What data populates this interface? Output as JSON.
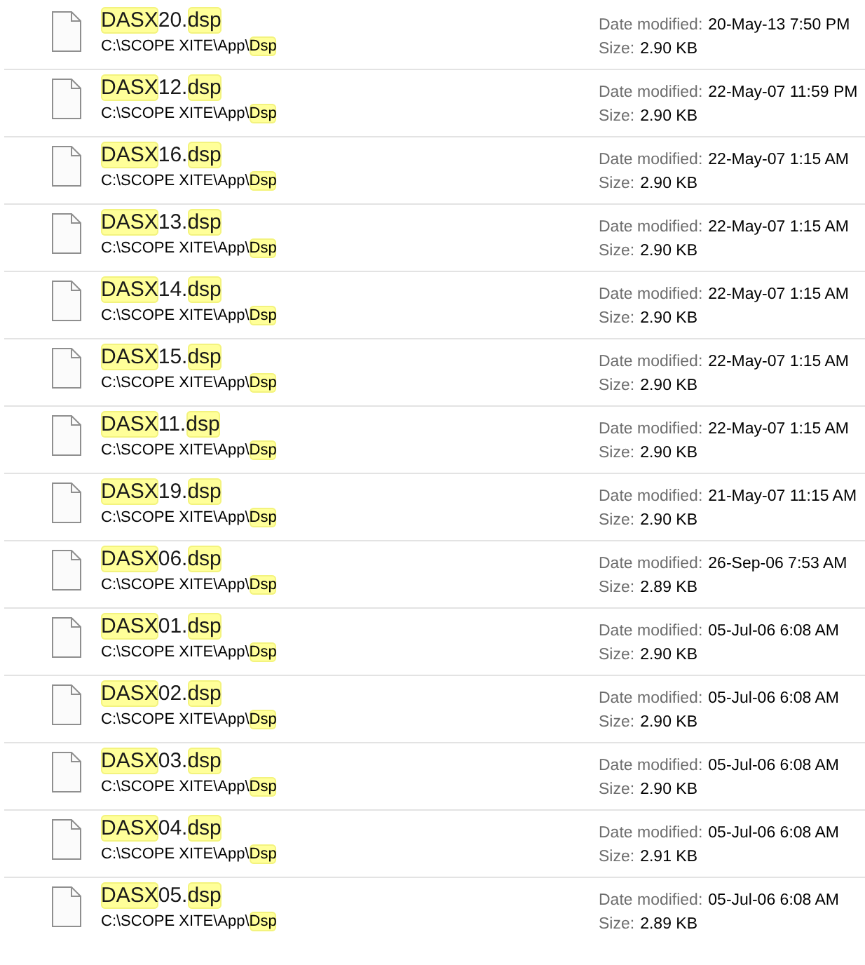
{
  "results": [
    {
      "name_parts": [
        {
          "text": "DASX",
          "highlighted": true
        },
        {
          "text": "20.",
          "highlighted": false
        },
        {
          "text": "dsp",
          "highlighted": true
        }
      ],
      "path_parts": [
        {
          "text": "C:\\SCOPE XITE\\App\\",
          "highlighted": false
        },
        {
          "text": "Dsp",
          "highlighted": true
        }
      ],
      "date_label": "Date modified:",
      "date": "20-May-13 7:50 PM",
      "size_label": "Size:",
      "size": "2.90 KB"
    },
    {
      "name_parts": [
        {
          "text": "DASX",
          "highlighted": true
        },
        {
          "text": "12.",
          "highlighted": false
        },
        {
          "text": "dsp",
          "highlighted": true
        }
      ],
      "path_parts": [
        {
          "text": "C:\\SCOPE XITE\\App\\",
          "highlighted": false
        },
        {
          "text": "Dsp",
          "highlighted": true
        }
      ],
      "date_label": "Date modified:",
      "date": "22-May-07 11:59 PM",
      "size_label": "Size:",
      "size": "2.90 KB"
    },
    {
      "name_parts": [
        {
          "text": "DASX",
          "highlighted": true
        },
        {
          "text": "16.",
          "highlighted": false
        },
        {
          "text": "dsp",
          "highlighted": true
        }
      ],
      "path_parts": [
        {
          "text": "C:\\SCOPE XITE\\App\\",
          "highlighted": false
        },
        {
          "text": "Dsp",
          "highlighted": true
        }
      ],
      "date_label": "Date modified:",
      "date": "22-May-07 1:15 AM",
      "size_label": "Size:",
      "size": "2.90 KB"
    },
    {
      "name_parts": [
        {
          "text": "DASX",
          "highlighted": true
        },
        {
          "text": "13.",
          "highlighted": false
        },
        {
          "text": "dsp",
          "highlighted": true
        }
      ],
      "path_parts": [
        {
          "text": "C:\\SCOPE XITE\\App\\",
          "highlighted": false
        },
        {
          "text": "Dsp",
          "highlighted": true
        }
      ],
      "date_label": "Date modified:",
      "date": "22-May-07 1:15 AM",
      "size_label": "Size:",
      "size": "2.90 KB"
    },
    {
      "name_parts": [
        {
          "text": "DASX",
          "highlighted": true
        },
        {
          "text": "14.",
          "highlighted": false
        },
        {
          "text": "dsp",
          "highlighted": true
        }
      ],
      "path_parts": [
        {
          "text": "C:\\SCOPE XITE\\App\\",
          "highlighted": false
        },
        {
          "text": "Dsp",
          "highlighted": true
        }
      ],
      "date_label": "Date modified:",
      "date": "22-May-07 1:15 AM",
      "size_label": "Size:",
      "size": "2.90 KB"
    },
    {
      "name_parts": [
        {
          "text": "DASX",
          "highlighted": true
        },
        {
          "text": "15.",
          "highlighted": false
        },
        {
          "text": "dsp",
          "highlighted": true
        }
      ],
      "path_parts": [
        {
          "text": "C:\\SCOPE XITE\\App\\",
          "highlighted": false
        },
        {
          "text": "Dsp",
          "highlighted": true
        }
      ],
      "date_label": "Date modified:",
      "date": "22-May-07 1:15 AM",
      "size_label": "Size:",
      "size": "2.90 KB"
    },
    {
      "name_parts": [
        {
          "text": "DASX",
          "highlighted": true
        },
        {
          "text": "11.",
          "highlighted": false
        },
        {
          "text": "dsp",
          "highlighted": true
        }
      ],
      "path_parts": [
        {
          "text": "C:\\SCOPE XITE\\App\\",
          "highlighted": false
        },
        {
          "text": "Dsp",
          "highlighted": true
        }
      ],
      "date_label": "Date modified:",
      "date": "22-May-07 1:15 AM",
      "size_label": "Size:",
      "size": "2.90 KB"
    },
    {
      "name_parts": [
        {
          "text": "DASX",
          "highlighted": true
        },
        {
          "text": "19.",
          "highlighted": false
        },
        {
          "text": "dsp",
          "highlighted": true
        }
      ],
      "path_parts": [
        {
          "text": "C:\\SCOPE XITE\\App\\",
          "highlighted": false
        },
        {
          "text": "Dsp",
          "highlighted": true
        }
      ],
      "date_label": "Date modified:",
      "date": "21-May-07 11:15 AM",
      "size_label": "Size:",
      "size": "2.90 KB"
    },
    {
      "name_parts": [
        {
          "text": "DASX",
          "highlighted": true
        },
        {
          "text": "06.",
          "highlighted": false
        },
        {
          "text": "dsp",
          "highlighted": true
        }
      ],
      "path_parts": [
        {
          "text": "C:\\SCOPE XITE\\App\\",
          "highlighted": false
        },
        {
          "text": "Dsp",
          "highlighted": true
        }
      ],
      "date_label": "Date modified:",
      "date": "26-Sep-06 7:53 AM",
      "size_label": "Size:",
      "size": "2.89 KB"
    },
    {
      "name_parts": [
        {
          "text": "DASX",
          "highlighted": true
        },
        {
          "text": "01.",
          "highlighted": false
        },
        {
          "text": "dsp",
          "highlighted": true
        }
      ],
      "path_parts": [
        {
          "text": "C:\\SCOPE XITE\\App\\",
          "highlighted": false
        },
        {
          "text": "Dsp",
          "highlighted": true
        }
      ],
      "date_label": "Date modified:",
      "date": "05-Jul-06 6:08 AM",
      "size_label": "Size:",
      "size": "2.90 KB"
    },
    {
      "name_parts": [
        {
          "text": "DASX",
          "highlighted": true
        },
        {
          "text": "02.",
          "highlighted": false
        },
        {
          "text": "dsp",
          "highlighted": true
        }
      ],
      "path_parts": [
        {
          "text": "C:\\SCOPE XITE\\App\\",
          "highlighted": false
        },
        {
          "text": "Dsp",
          "highlighted": true
        }
      ],
      "date_label": "Date modified:",
      "date": "05-Jul-06 6:08 AM",
      "size_label": "Size:",
      "size": "2.90 KB"
    },
    {
      "name_parts": [
        {
          "text": "DASX",
          "highlighted": true
        },
        {
          "text": "03.",
          "highlighted": false
        },
        {
          "text": "dsp",
          "highlighted": true
        }
      ],
      "path_parts": [
        {
          "text": "C:\\SCOPE XITE\\App\\",
          "highlighted": false
        },
        {
          "text": "Dsp",
          "highlighted": true
        }
      ],
      "date_label": "Date modified:",
      "date": "05-Jul-06 6:08 AM",
      "size_label": "Size:",
      "size": "2.90 KB"
    },
    {
      "name_parts": [
        {
          "text": "DASX",
          "highlighted": true
        },
        {
          "text": "04.",
          "highlighted": false
        },
        {
          "text": "dsp",
          "highlighted": true
        }
      ],
      "path_parts": [
        {
          "text": "C:\\SCOPE XITE\\App\\",
          "highlighted": false
        },
        {
          "text": "Dsp",
          "highlighted": true
        }
      ],
      "date_label": "Date modified:",
      "date": "05-Jul-06 6:08 AM",
      "size_label": "Size:",
      "size": "2.91 KB"
    },
    {
      "name_parts": [
        {
          "text": "DASX",
          "highlighted": true
        },
        {
          "text": "05.",
          "highlighted": false
        },
        {
          "text": "dsp",
          "highlighted": true
        }
      ],
      "path_parts": [
        {
          "text": "C:\\SCOPE XITE\\App\\",
          "highlighted": false
        },
        {
          "text": "Dsp",
          "highlighted": true
        }
      ],
      "date_label": "Date modified:",
      "date": "05-Jul-06 6:08 AM",
      "size_label": "Size:",
      "size": "2.89 KB"
    }
  ]
}
